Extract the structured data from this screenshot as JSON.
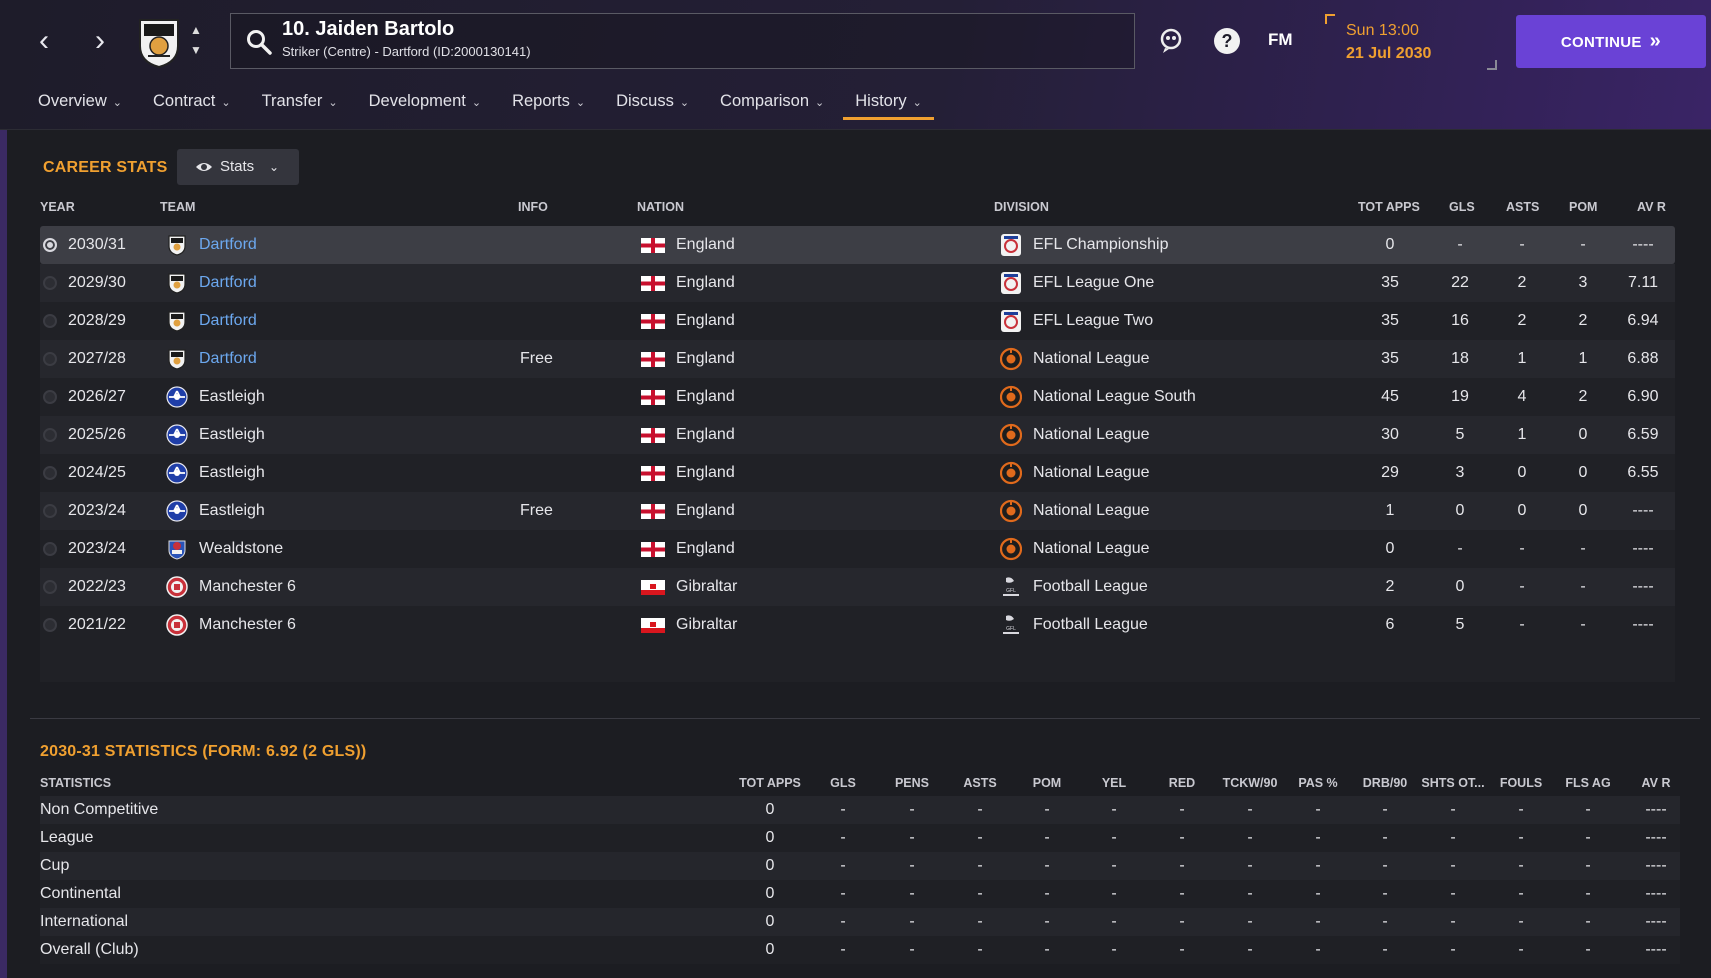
{
  "header": {
    "player_name": "10. Jaiden Bartolo",
    "player_subtitle": "Striker (Centre) - Dartford (ID:2000130141)",
    "fm_label": "FM",
    "date_day": "Sun 13:00",
    "date_date": "21 Jul 2030",
    "continue_label": "CONTINUE"
  },
  "tabs": [
    {
      "label": "Overview"
    },
    {
      "label": "Contract"
    },
    {
      "label": "Transfer"
    },
    {
      "label": "Development"
    },
    {
      "label": "Reports"
    },
    {
      "label": "Discuss"
    },
    {
      "label": "Comparison"
    },
    {
      "label": "History",
      "active": true
    }
  ],
  "career": {
    "title": "CAREER STATS",
    "view_dropdown": "Stats",
    "columns": [
      "YEAR",
      "TEAM",
      "INFO",
      "NATION",
      "DIVISION",
      "TOT APPS",
      "GLS",
      "ASTS",
      "POM",
      "AV R"
    ],
    "rows": [
      {
        "year": "2030/31",
        "team": "Dartford",
        "info": "",
        "nation": "England",
        "division": "EFL Championship",
        "apps": "0",
        "gls": "-",
        "asts": "-",
        "pom": "-",
        "avr": "----"
      },
      {
        "year": "2029/30",
        "team": "Dartford",
        "info": "",
        "nation": "England",
        "division": "EFL League One",
        "apps": "35",
        "gls": "22",
        "asts": "2",
        "pom": "3",
        "avr": "7.11"
      },
      {
        "year": "2028/29",
        "team": "Dartford",
        "info": "",
        "nation": "England",
        "division": "EFL League Two",
        "apps": "35",
        "gls": "16",
        "asts": "2",
        "pom": "2",
        "avr": "6.94"
      },
      {
        "year": "2027/28",
        "team": "Dartford",
        "info": "Free",
        "nation": "England",
        "division": "National League",
        "apps": "35",
        "gls": "18",
        "asts": "1",
        "pom": "1",
        "avr": "6.88"
      },
      {
        "year": "2026/27",
        "team": "Eastleigh",
        "info": "",
        "nation": "England",
        "division": "National League South",
        "apps": "45",
        "gls": "19",
        "asts": "4",
        "pom": "2",
        "avr": "6.90"
      },
      {
        "year": "2025/26",
        "team": "Eastleigh",
        "info": "",
        "nation": "England",
        "division": "National League",
        "apps": "30",
        "gls": "5",
        "asts": "1",
        "pom": "0",
        "avr": "6.59"
      },
      {
        "year": "2024/25",
        "team": "Eastleigh",
        "info": "",
        "nation": "England",
        "division": "National League",
        "apps": "29",
        "gls": "3",
        "asts": "0",
        "pom": "0",
        "avr": "6.55"
      },
      {
        "year": "2023/24",
        "team": "Eastleigh",
        "info": "Free",
        "nation": "England",
        "division": "National League",
        "apps": "1",
        "gls": "0",
        "asts": "0",
        "pom": "0",
        "avr": "----"
      },
      {
        "year": "2023/24",
        "team": "Wealdstone",
        "info": "",
        "nation": "England",
        "division": "National League",
        "apps": "0",
        "gls": "-",
        "asts": "-",
        "pom": "-",
        "avr": "----"
      },
      {
        "year": "2022/23",
        "team": "Manchester 6",
        "info": "",
        "nation": "Gibraltar",
        "division": "Football League",
        "apps": "2",
        "gls": "0",
        "asts": "-",
        "pom": "-",
        "avr": "----"
      },
      {
        "year": "2021/22",
        "team": "Manchester 6",
        "info": "",
        "nation": "Gibraltar",
        "division": "Football League",
        "apps": "6",
        "gls": "5",
        "asts": "-",
        "pom": "-",
        "avr": "----"
      }
    ]
  },
  "season_stats": {
    "title": "2030-31 STATISTICS (FORM: 6.92 (2 GLS))",
    "columns": [
      "STATISTICS",
      "TOT APPS",
      "GLS",
      "PENS",
      "ASTS",
      "POM",
      "YEL",
      "RED",
      "TCKW/90",
      "PAS %",
      "DRB/90",
      "SHTS OT...",
      "FOULS",
      "FLS AG",
      "AV R"
    ],
    "rows": [
      {
        "label": "Non Competitive",
        "values": [
          "0",
          "-",
          "-",
          "-",
          "-",
          "-",
          "-",
          "-",
          "-",
          "-",
          "-",
          "-",
          "-",
          "----"
        ]
      },
      {
        "label": "League",
        "values": [
          "0",
          "-",
          "-",
          "-",
          "-",
          "-",
          "-",
          "-",
          "-",
          "-",
          "-",
          "-",
          "-",
          "----"
        ]
      },
      {
        "label": "Cup",
        "values": [
          "0",
          "-",
          "-",
          "-",
          "-",
          "-",
          "-",
          "-",
          "-",
          "-",
          "-",
          "-",
          "-",
          "----"
        ]
      },
      {
        "label": "Continental",
        "values": [
          "0",
          "-",
          "-",
          "-",
          "-",
          "-",
          "-",
          "-",
          "-",
          "-",
          "-",
          "-",
          "-",
          "----"
        ]
      },
      {
        "label": "International",
        "values": [
          "0",
          "-",
          "-",
          "-",
          "-",
          "-",
          "-",
          "-",
          "-",
          "-",
          "-",
          "-",
          "-",
          "----"
        ]
      },
      {
        "label": "Overall (Club)",
        "values": [
          "0",
          "-",
          "-",
          "-",
          "-",
          "-",
          "-",
          "-",
          "-",
          "-",
          "-",
          "-",
          "-",
          "----"
        ]
      }
    ]
  },
  "colors": {
    "accent": "#f0a030",
    "continue_button": "#6a42d6",
    "link": "#6ca8ef"
  }
}
